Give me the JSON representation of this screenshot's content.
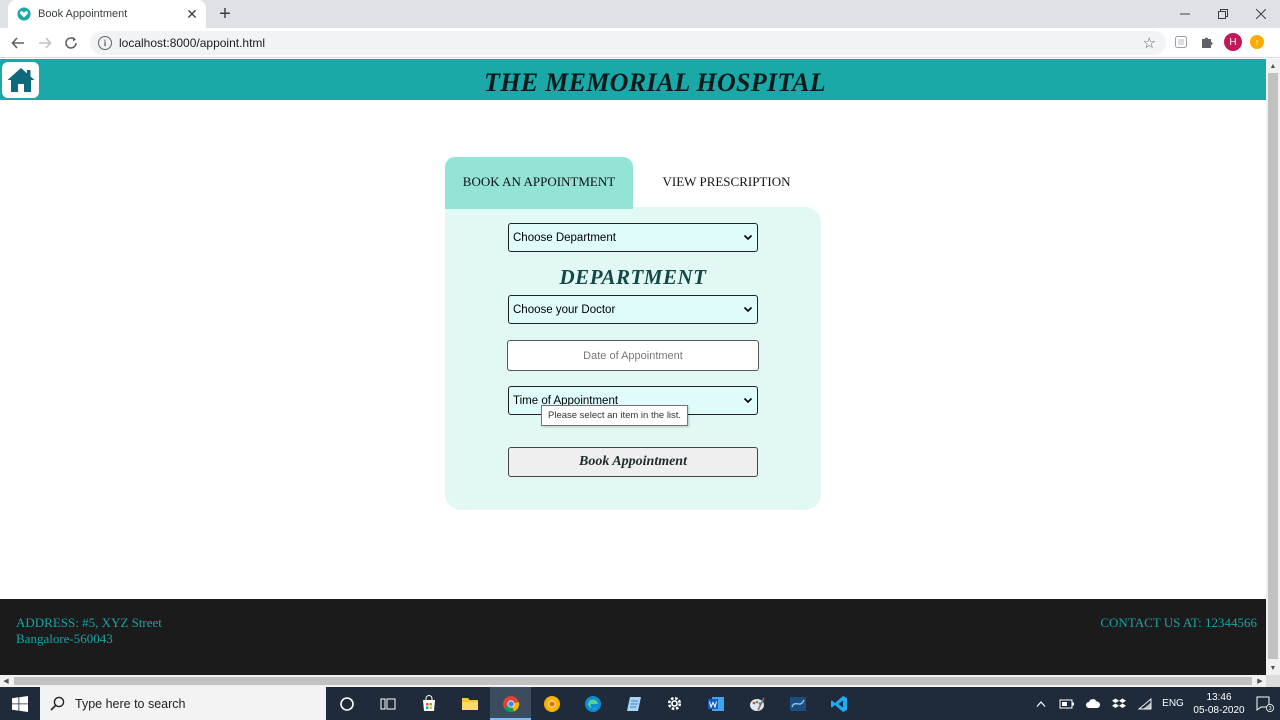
{
  "browser": {
    "tab_title": "Book Appointment",
    "new_tab_symbol": "+",
    "url": "localhost:8000/appoint.html",
    "avatar_letter": "H"
  },
  "page": {
    "header_title": "THE MEMORIAL HOSPITAL",
    "tabs": {
      "book": "BOOK AN APPOINTMENT",
      "view": "VIEW PRESCRIPTION"
    },
    "form": {
      "department_select": "Choose Department",
      "department_heading": "DEPARTMENT",
      "doctor_select": "Choose your Doctor",
      "date_placeholder": "Date of Appointment",
      "time_select": "Time of Appointment",
      "validation_tooltip": "Please select an item in the list.",
      "submit_label": "Book Appointment"
    },
    "footer": {
      "address_line1": "ADDRESS: #5, XYZ Street",
      "address_line2": "Bangalore-560043",
      "contact": "CONTACT US AT: 12344566"
    }
  },
  "taskbar": {
    "search_placeholder": "Type here to search",
    "language": "ENG",
    "time": "13:46",
    "date": "05-08-2020",
    "notification_count": "3"
  },
  "colors": {
    "header_teal": "#1aa8a8",
    "tab_active": "#93e3d6",
    "card_bg": "#e1f8f5",
    "footer_bg": "#1b1b1b",
    "footer_text": "#19a3a3"
  },
  "icons": [
    "hospital-favicon-icon",
    "home-icon",
    "chevron-down-icon",
    "windows-logo-icon",
    "search-icon"
  ]
}
